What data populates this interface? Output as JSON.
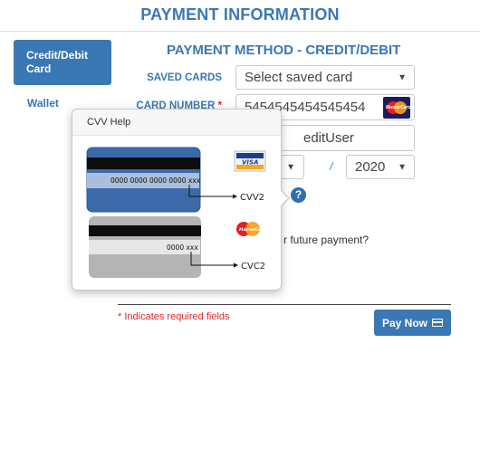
{
  "header": {
    "title": "PAYMENT INFORMATION"
  },
  "nav": {
    "credit_debit_label": "Credit/Debit Card",
    "wallet_label": "Wallet"
  },
  "form": {
    "section_title": "PAYMENT METHOD - CREDIT/DEBIT",
    "saved_cards_label": "SAVED CARDS",
    "saved_cards_value": "Select saved card",
    "card_number_label": "CARD NUMBER",
    "required_marker": "*",
    "card_number_value": "5454545454545454",
    "card_name_value": "editUser",
    "expiry_year_value": "2020",
    "expiry_separator": "/",
    "save_card_text": "r future payment?",
    "required_note": "* Indicates required fields",
    "pay_button_label": "Pay Now"
  },
  "cvv_help": {
    "title": "CVV Help",
    "visa_card_number": "0000 0000 0000 0000 xxx",
    "visa_code_label": "CVV2",
    "visa_brand": "VISA",
    "mc_card_number": "0000 xxx",
    "mc_code_label": "CVC2",
    "mc_brand": "MasterCard"
  },
  "brand_logo_text": "MasterCard",
  "icons": {
    "caret": "chevron-down-icon",
    "help": "question-icon",
    "card": "credit-card-icon",
    "mastercard": "mastercard-logo-icon",
    "visa": "visa-logo-icon"
  },
  "colors": {
    "primary": "#3a78b4",
    "required": "#d9262b"
  }
}
